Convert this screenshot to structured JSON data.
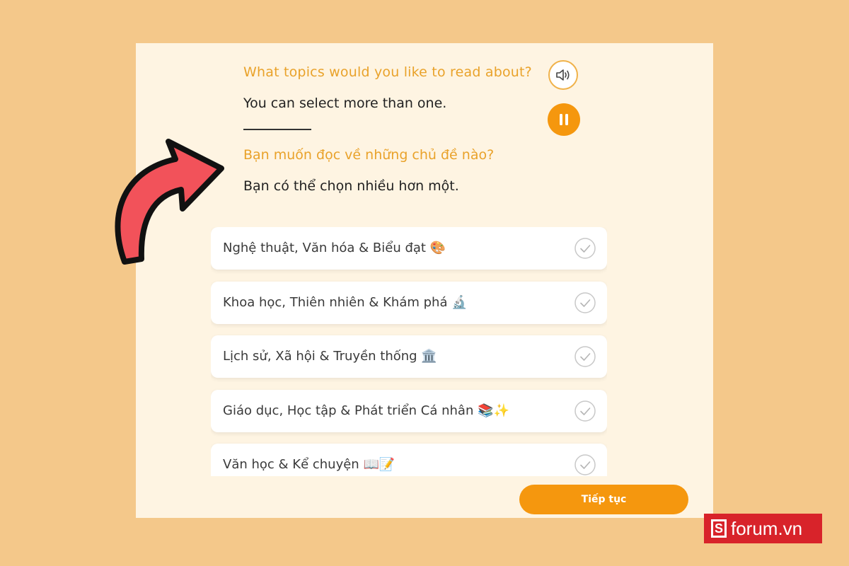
{
  "header": {
    "question_en": "What topics would you like to read about?",
    "subtitle_en": "You can select more than one.",
    "question_vi": "Bạn muốn đọc về những chủ đề nào?",
    "subtitle_vi": "Bạn có thể chọn nhiều hơn một."
  },
  "controls": {
    "audio_icon": "speaker-icon",
    "pause_icon": "pause-icon"
  },
  "topics": [
    {
      "label": "Nghệ thuật, Văn hóa & Biểu đạt 🎨"
    },
    {
      "label": "Khoa học, Thiên nhiên & Khám phá 🔬"
    },
    {
      "label": "Lịch sử, Xã hội & Truyền thống 🏛️"
    },
    {
      "label": "Giáo dục, Học tập & Phát triển Cá nhân 📚✨"
    },
    {
      "label": "Văn học & Kể chuyện 📖📝"
    }
  ],
  "footer": {
    "continue_label": "Tiếp tục"
  },
  "branding": {
    "mark": "S",
    "text": "forum.vn"
  },
  "colors": {
    "accent": "#f5970e",
    "question": "#e9a22a",
    "background": "#f4c88a",
    "panel": "#fef4e2",
    "arrow": "#f2525a",
    "brand": "#d8232a"
  }
}
